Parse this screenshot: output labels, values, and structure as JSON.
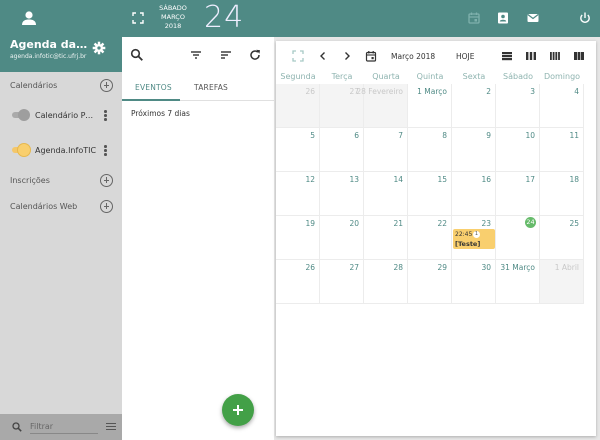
{
  "topbar": {
    "date_lines": [
      "SÁBADO",
      "MARÇO",
      "2018"
    ],
    "day_number": "24"
  },
  "sidebar": {
    "title": "Agenda da Informática",
    "email": "agenda.infotic@tic.ufrj.br",
    "sections": {
      "calendars": "Calendários",
      "subscriptions": "Inscrições",
      "web_calendars": "Calendários Web"
    },
    "calendars": [
      {
        "name": "Calendário Pessoal",
        "enabled": false,
        "color": "#9e9e9e"
      },
      {
        "name": "Agenda.InfoTIC",
        "enabled": true,
        "color": "#f9cf6e"
      }
    ],
    "filter_placeholder": "Filtrar"
  },
  "events_panel": {
    "tabs": [
      "EVENTOS",
      "TAREFAS"
    ],
    "active_tab": "EVENTOS",
    "subtitle": "Próximos 7 dias"
  },
  "calendar": {
    "month_label": "Março 2018",
    "today_label": "HOJE",
    "weekdays": [
      "Segunda",
      "Terça",
      "Quarta",
      "Quinta",
      "Sexta",
      "Sábado",
      "Domingo"
    ],
    "weeks": [
      [
        {
          "label": "26",
          "dim": true
        },
        {
          "label": "27",
          "dim": true
        },
        {
          "label": "28 Fevereiro",
          "dim": true
        },
        {
          "label": "1 Março"
        },
        {
          "label": "2"
        },
        {
          "label": "3"
        },
        {
          "label": "4"
        }
      ],
      [
        {
          "label": "5"
        },
        {
          "label": "6"
        },
        {
          "label": "7"
        },
        {
          "label": "8"
        },
        {
          "label": "9"
        },
        {
          "label": "10"
        },
        {
          "label": "11"
        }
      ],
      [
        {
          "label": "12"
        },
        {
          "label": "13"
        },
        {
          "label": "14"
        },
        {
          "label": "15"
        },
        {
          "label": "16"
        },
        {
          "label": "17"
        },
        {
          "label": "18"
        }
      ],
      [
        {
          "label": "19"
        },
        {
          "label": "20"
        },
        {
          "label": "21"
        },
        {
          "label": "22"
        },
        {
          "label": "23",
          "event": {
            "time": "22:45",
            "badge": "1",
            "title": "[Teste]"
          }
        },
        {
          "label": "24",
          "today": true
        },
        {
          "label": "25"
        }
      ],
      [
        {
          "label": "26"
        },
        {
          "label": "27"
        },
        {
          "label": "28"
        },
        {
          "label": "29"
        },
        {
          "label": "30"
        },
        {
          "label": "31 Março"
        },
        {
          "label": "1 Abril",
          "dim": true
        }
      ]
    ]
  },
  "colors": {
    "accent": "#4f8a85",
    "event": "#f9cf6e",
    "today": "#66bb6a",
    "fab": "#43a047"
  }
}
